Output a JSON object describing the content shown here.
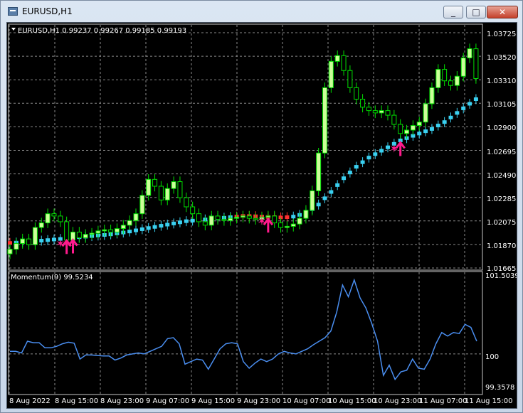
{
  "window": {
    "title": "EURUSD,H1",
    "buttons": [
      "_",
      "□",
      "✕"
    ]
  },
  "main_pane": {
    "info": "EURUSD,H1  0.99237 0.99267 0.99185 0.99193",
    "price_labels": [
      "1.03725",
      "1.03520",
      "1.03310",
      "1.03105",
      "1.02900",
      "1.02695",
      "1.02490",
      "1.02285",
      "1.02075",
      "1.01870",
      "1.01665"
    ]
  },
  "sub_pane": {
    "info": "Momentum(9) 99.5234",
    "labels": [
      "101.5039",
      "100",
      "99.3578"
    ]
  },
  "time_axis": [
    "8 Aug 2022",
    "8 Aug 15:00",
    "8 Aug 23:00",
    "9 Aug 07:00",
    "9 Aug 15:00",
    "9 Aug 23:00",
    "10 Aug 07:00",
    "10 Aug 15:00",
    "10 Aug 23:00",
    "11 Aug 07:00",
    "11 Aug 15:00"
  ],
  "colors": {
    "bull_candle": "#ccff99",
    "candle_border": "#00e000",
    "ma_cyan": "#3ad0f0",
    "ma_red": "#ff3030",
    "signal_magenta": "#ff1a8c",
    "momentum_line": "#4a8ef0",
    "grid": "#8a8a8a"
  },
  "chart_data": [
    {
      "type": "candlestick",
      "title": "EURUSD,H1",
      "ylim": [
        1.01665,
        1.03725
      ],
      "x_labels": [
        "8 Aug 2022",
        "8 Aug 15:00",
        "8 Aug 23:00",
        "9 Aug 07:00",
        "9 Aug 15:00",
        "9 Aug 23:00",
        "10 Aug 07:00",
        "10 Aug 15:00",
        "10 Aug 23:00",
        "11 Aug 07:00",
        "11 Aug 15:00"
      ],
      "close_series": [
        1.0181,
        1.0186,
        1.019,
        1.0185,
        1.02,
        1.0204,
        1.0212,
        1.021,
        1.0205,
        1.0189,
        1.0196,
        1.0191,
        1.0194,
        1.0195,
        1.0197,
        1.0198,
        1.0196,
        1.0199,
        1.0202,
        1.0206,
        1.0212,
        1.0228,
        1.0242,
        1.0236,
        1.0224,
        1.0234,
        1.024,
        1.0226,
        1.0218,
        1.0212,
        1.0205,
        1.0202,
        1.021,
        1.0207,
        1.0206,
        1.0208,
        1.0209,
        1.021,
        1.0208,
        1.0207,
        1.0209,
        1.021,
        1.0204,
        1.02,
        1.0201,
        1.0203,
        1.0208,
        1.0215,
        1.0232,
        1.0265,
        1.0322,
        1.0345,
        1.035,
        1.0337,
        1.0322,
        1.0312,
        1.0305,
        1.0302,
        1.03,
        1.0302,
        1.0298,
        1.029,
        1.0282,
        1.0285,
        1.0289,
        1.0292,
        1.0308,
        1.0322,
        1.0338,
        1.0328,
        1.0324,
        1.0332,
        1.0348,
        1.0356,
        1.033
      ],
      "ma_cyan": [
        1.01865,
        1.01868,
        1.01872,
        1.01876,
        1.0188,
        1.01885,
        1.0189,
        1.01895,
        1.019,
        1.01905,
        1.0191,
        1.01915,
        1.0192,
        1.01925,
        1.0193,
        1.01935,
        1.0194,
        1.01948,
        1.01956,
        1.01965,
        1.01975,
        1.01985,
        1.01995,
        1.02005,
        1.02015,
        1.02025,
        1.02035,
        1.02045,
        1.02055,
        1.0206,
        1.02065,
        1.0207,
        1.02075,
        1.0208,
        1.02085,
        1.0209,
        1.02095,
        1.021,
        1.021,
        1.02098,
        1.02095,
        1.02092,
        1.0209,
        1.02088,
        1.0209,
        1.02095,
        1.0211,
        1.0213,
        1.0216,
        1.022,
        1.02255,
        1.0231,
        1.0237,
        1.0243,
        1.0248,
        1.0253,
        1.0257,
        1.0261,
        1.0264,
        1.0267,
        1.027,
        1.0273,
        1.0276,
        1.0278,
        1.028,
        1.0282,
        1.0284,
        1.0286,
        1.0289,
        1.0292,
        1.0296,
        1.03,
        1.0304,
        1.0308,
        1.0312
      ],
      "signals": [
        {
          "index": 8,
          "type": "star"
        },
        {
          "index": 9,
          "type": "arrow-up"
        },
        {
          "index": 10,
          "type": "arrow-up"
        },
        {
          "index": 40,
          "type": "star"
        },
        {
          "index": 41,
          "type": "arrow-up"
        },
        {
          "index": 61,
          "type": "star"
        },
        {
          "index": 62,
          "type": "arrow-up"
        }
      ]
    },
    {
      "type": "line",
      "title": "Momentum(9) 99.5234",
      "ylim": [
        99.3578,
        101.5039
      ],
      "reference": 100,
      "values": [
        100.05,
        100.05,
        100.02,
        100.25,
        100.22,
        100.22,
        100.12,
        100.12,
        100.15,
        100.2,
        100.23,
        100.21,
        99.9,
        99.98,
        99.98,
        99.97,
        99.96,
        99.96,
        99.88,
        99.92,
        99.98,
        100.0,
        100.02,
        100.0,
        100.05,
        100.1,
        100.15,
        100.3,
        100.32,
        100.2,
        99.8,
        99.85,
        99.9,
        99.88,
        99.7,
        99.9,
        100.1,
        100.2,
        100.22,
        100.2,
        99.85,
        99.72,
        99.82,
        99.9,
        99.85,
        99.9,
        100.0,
        100.05,
        100.02,
        100.0,
        100.05,
        100.1,
        100.18,
        100.25,
        100.32,
        100.45,
        100.82,
        101.35,
        101.12,
        101.45,
        101.1,
        100.9,
        100.6,
        100.25,
        99.58,
        99.78,
        99.5,
        99.65,
        99.68,
        99.9,
        99.72,
        99.7,
        99.9,
        100.2,
        100.42,
        100.35,
        100.42,
        100.4,
        100.58,
        100.52,
        100.25
      ]
    }
  ]
}
